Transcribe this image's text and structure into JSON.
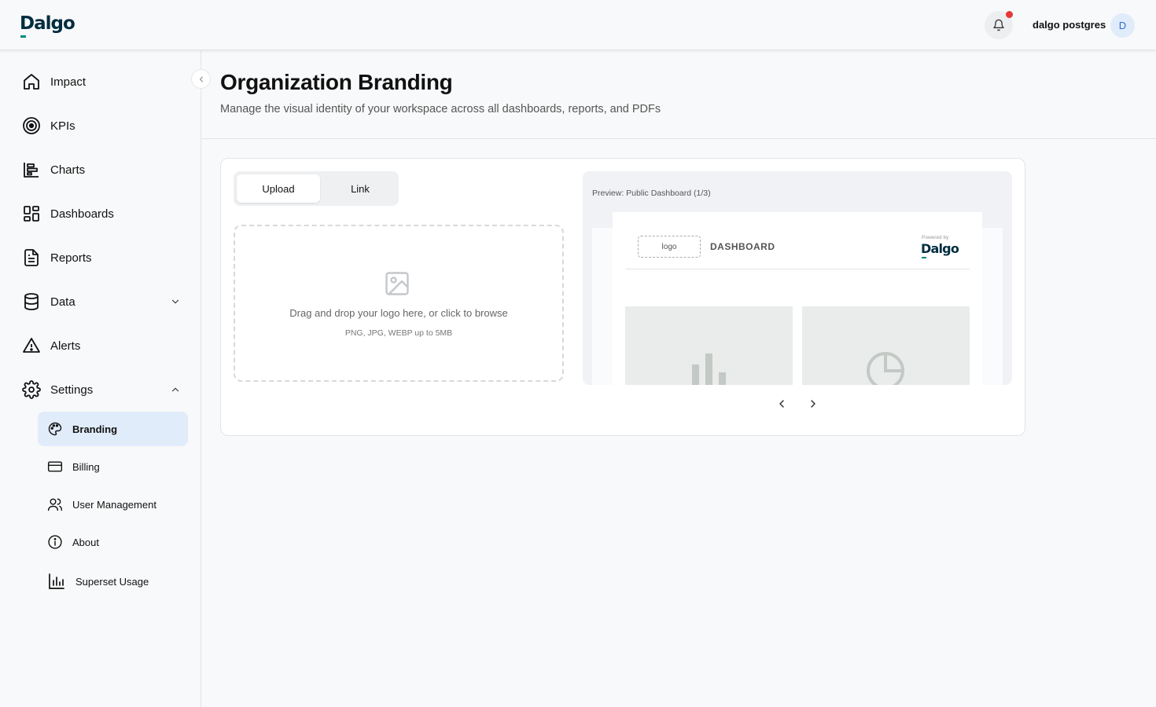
{
  "app": {
    "logo_text": "Dalgo"
  },
  "topbar": {
    "username": "dalgo postgres",
    "avatar_initial": "D"
  },
  "sidebar": {
    "items": [
      {
        "label": "Impact",
        "icon": "home-icon"
      },
      {
        "label": "KPIs",
        "icon": "target-icon"
      },
      {
        "label": "Charts",
        "icon": "bar-chart-icon"
      },
      {
        "label": "Dashboards",
        "icon": "grid-icon"
      },
      {
        "label": "Reports",
        "icon": "document-icon"
      },
      {
        "label": "Data",
        "icon": "database-icon",
        "expanded": false
      },
      {
        "label": "Alerts",
        "icon": "warning-icon"
      },
      {
        "label": "Settings",
        "icon": "gear-icon",
        "expanded": true
      }
    ],
    "settings_items": [
      {
        "label": "Branding",
        "icon": "palette-icon",
        "active": true
      },
      {
        "label": "Billing",
        "icon": "credit-card-icon"
      },
      {
        "label": "User Management",
        "icon": "users-icon"
      },
      {
        "label": "About",
        "icon": "info-icon"
      },
      {
        "label": "Superset Usage",
        "icon": "chart-usage-icon"
      }
    ]
  },
  "main": {
    "title": "Organization Branding",
    "subtitle": "Manage the visual identity of your workspace across all dashboards, reports, and PDFs",
    "tabs": [
      {
        "label": "Upload",
        "active": true
      },
      {
        "label": "Link",
        "active": false
      }
    ],
    "dropzone": {
      "text": "Drag and drop your logo here, or click to browse",
      "hint": "PNG, JPG, WEBP up to 5MB"
    },
    "preview": {
      "label": "Preview: Public Dashboard (1/3)",
      "logo_placeholder": "logo",
      "dashboard_label": "DASHBOARD",
      "powered_by": "Powered by",
      "brand": "Dalgo"
    }
  },
  "colors": {
    "accent": "#e1ecfb",
    "brand": "#002d40",
    "brand_bar": "#00897b",
    "notification": "#e53935"
  }
}
